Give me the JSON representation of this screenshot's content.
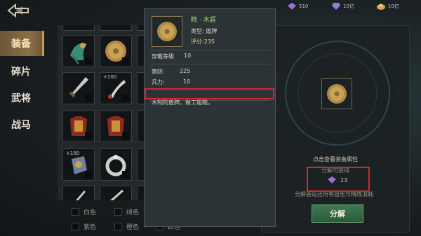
{
  "currency": [
    {
      "icon": "purple-crystal-icon",
      "amount": "510"
    },
    {
      "icon": "violet-gem-icon",
      "amount": "10亿"
    },
    {
      "icon": "gold-ingot-icon",
      "amount": "10亿"
    }
  ],
  "tabs": [
    {
      "label": "装备",
      "active": true
    },
    {
      "label": "碎片",
      "active": false
    },
    {
      "label": "武将",
      "active": false
    },
    {
      "label": "战马",
      "active": false
    }
  ],
  "grid": {
    "plus_labels": [
      "+100",
      "+100",
      "+100"
    ]
  },
  "filters": [
    "白色",
    "绿色",
    "紫色",
    "橙色",
    "红色"
  ],
  "tooltip": {
    "name": "精 · 木盾",
    "type": "类型: 盾牌",
    "score": "评分:235",
    "level_label": "穿戴等级",
    "level_value": "10",
    "stat1_label": "策防:",
    "stat1_value": "225",
    "stat2_label": "兵力:",
    "stat2_value": "10",
    "description": "木制的盾牌，做工粗糙。"
  },
  "right_panel": {
    "view_hint": "点击查看装备属性",
    "obtain_label": "分解可获得",
    "obtain_amount": "23",
    "refund_hint": "分解会返还所有强化与精炼消耗",
    "decompose_label": "分解"
  },
  "colors": {
    "accent_gold": "#c29a56",
    "highlight_red": "#d2272d",
    "item_green": "#9edb78",
    "score_gold": "#f1d27c",
    "button_green": "#3f7a52"
  }
}
